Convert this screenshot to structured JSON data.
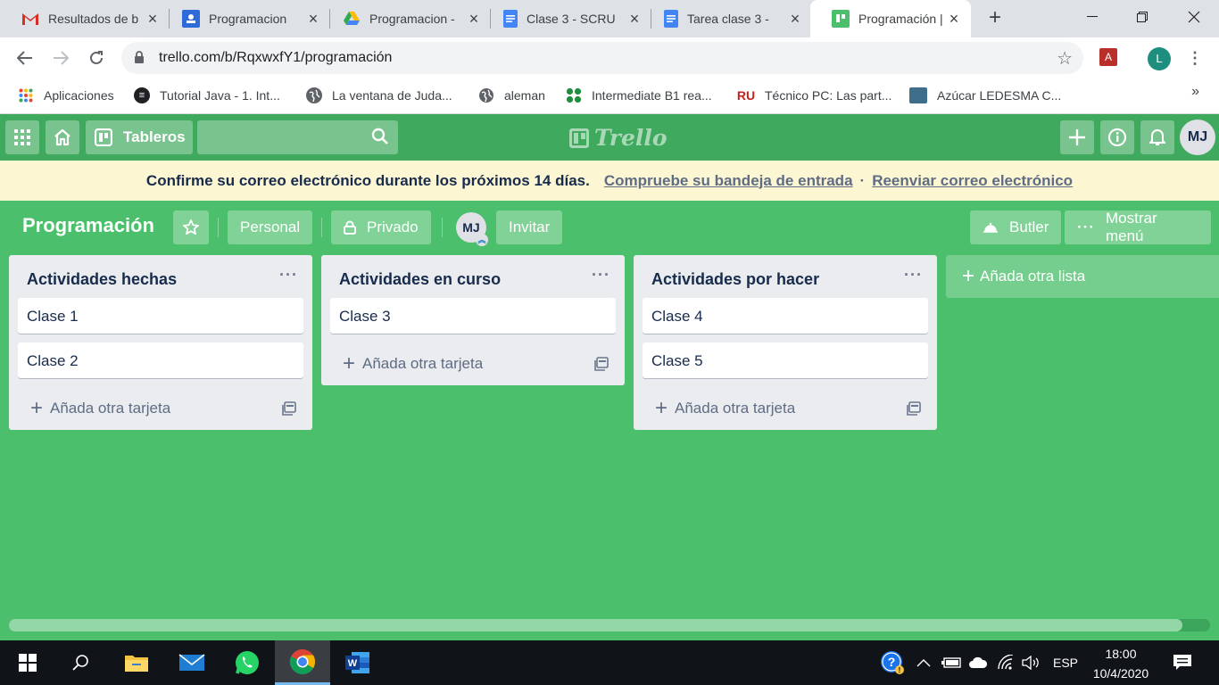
{
  "browser": {
    "tabs": [
      {
        "title": "Resultados de b",
        "icon": "gmail-icon"
      },
      {
        "title": "Programacion",
        "icon": "classroom-icon"
      },
      {
        "title": "Programacion -",
        "icon": "drive-icon"
      },
      {
        "title": "Clase 3 - SCRU",
        "icon": "docs-icon"
      },
      {
        "title": "Tarea clase 3 -",
        "icon": "docs-icon"
      },
      {
        "title": "Programación |",
        "icon": "trello-icon",
        "active": true
      }
    ],
    "url": "trello.com/b/RqxwxfY1/programación",
    "profile_initial": "L",
    "bookmarks": [
      {
        "label": "Aplicaciones",
        "icon": "apps-grid-icon"
      },
      {
        "label": "Tutorial Java - 1. Int...",
        "icon": "tutorial-icon"
      },
      {
        "label": "La ventana de Juda...",
        "icon": "globe-icon"
      },
      {
        "label": "aleman",
        "icon": "globe-icon"
      },
      {
        "label": "Intermediate B1 rea...",
        "icon": "dots-icon"
      },
      {
        "label": "Técnico PC: Las part...",
        "icon": "ru-icon",
        "badge": "RU"
      },
      {
        "label": "Azúcar LEDESMA C...",
        "icon": "image-icon"
      }
    ],
    "bookmarks_more": "»"
  },
  "trello": {
    "boards_label": "Tableros",
    "logo_text": "Trello",
    "user_initials": "MJ",
    "banner": {
      "message": "Confirme su correo electrónico durante los próximos 14 días.",
      "check_inbox": "Compruebe su bandeja de entrada",
      "separator": "·",
      "resend": "Reenviar correo electrónico"
    },
    "board": {
      "title": "Programación",
      "team": "Personal",
      "visibility": "Privado",
      "member_initials": "MJ",
      "invite": "Invitar",
      "butler": "Butler",
      "show_menu": "Mostrar menú"
    },
    "lists": [
      {
        "title": "Actividades hechas",
        "cards": [
          "Clase 1",
          "Clase 2"
        ]
      },
      {
        "title": "Actividades en curso",
        "cards": [
          "Clase 3"
        ]
      },
      {
        "title": "Actividades por hacer",
        "cards": [
          "Clase 4",
          "Clase 5"
        ]
      }
    ],
    "list_menu": "···",
    "add_card_label": "Añada otra tarjeta",
    "add_list_label": "Añada otra lista",
    "scroll_position": 0.977
  },
  "taskbar": {
    "language": "ESP",
    "time": "18:00",
    "date": "10/4/2020"
  },
  "colors": {
    "board_bg": "#4bbf6b",
    "header_bg": "#3fa95e",
    "banner_bg": "#fdf6d3"
  }
}
